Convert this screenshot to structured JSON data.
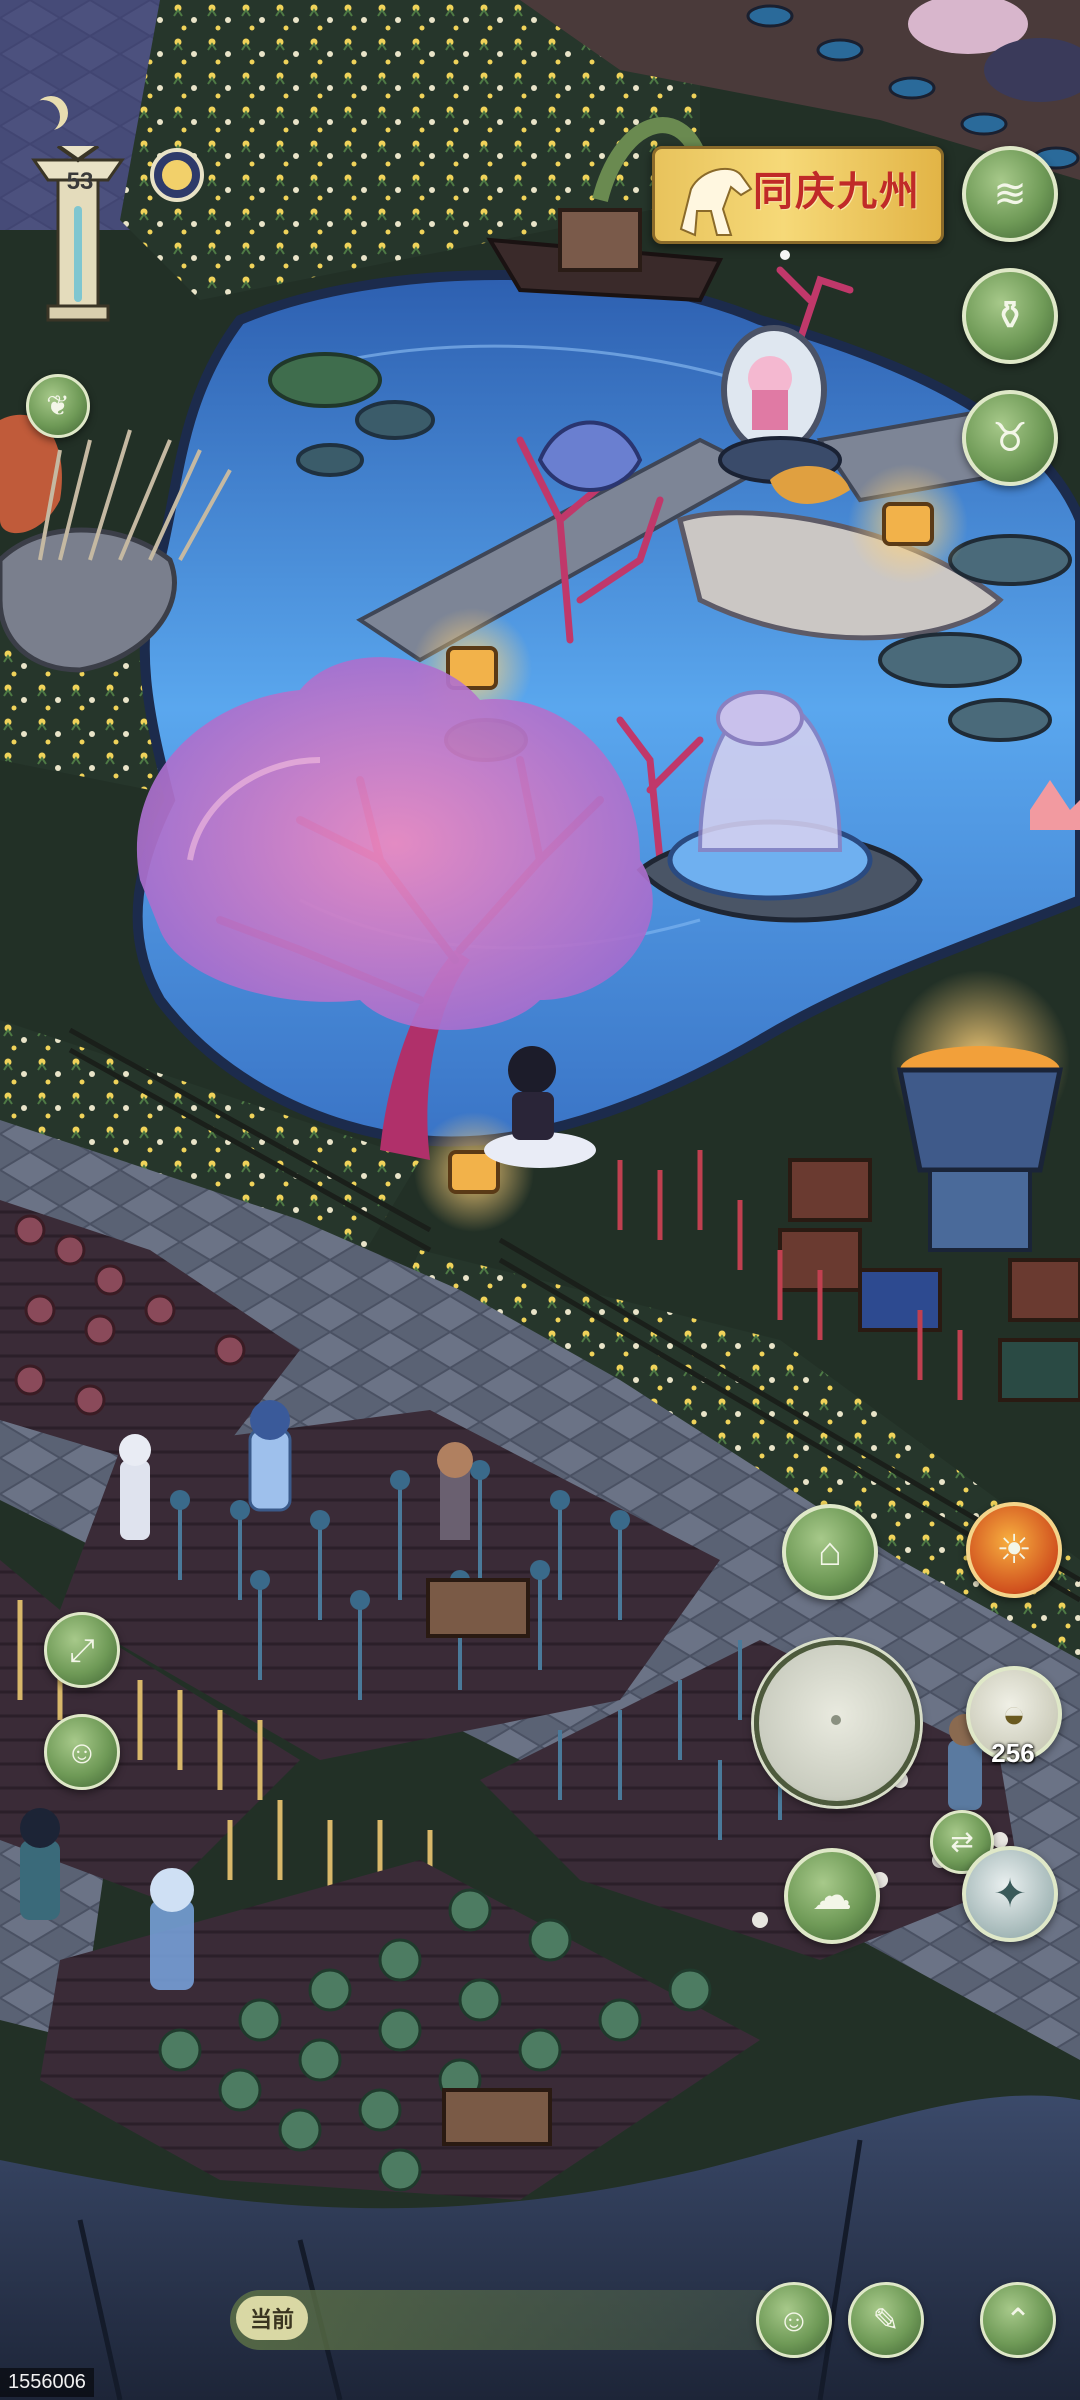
{
  "hud": {
    "level": "53",
    "festival_banner": {
      "text": "同庆九州"
    },
    "coin_count": "256",
    "current_label": "当前",
    "uid": "1556006"
  },
  "icons": {
    "moon": "crescent-moon-icon",
    "level_pillar": "totem-pillar-icon",
    "day_cycle": "sun-clock-icon",
    "leaf": "leaf-icon",
    "wave": "wave-icon",
    "jar": "jar-icon",
    "ox": "ox-head-icon",
    "basket": "seed-basket-icon",
    "lion_dance": "lion-dance-icon",
    "expand": "expand-arrows-icon",
    "character": "character-icon",
    "coin_dish": "coin-dish-icon",
    "swap": "swap-arrows-icon",
    "cloud": "cloud-swirl-icon",
    "compass": "compass-diamond-icon",
    "emote": "smile-face-icon",
    "build": "brush-build-icon",
    "collapse": "chevron-up-icon"
  },
  "colors": {
    "pond": "#4f8fd8",
    "tree_blossom": "#d36aa6",
    "grass": "#2a3b2d",
    "soil": "#3b2d38",
    "path": "#5d6576",
    "button_green": "#6f9a57",
    "banner_gold": "#f6d978",
    "banner_text": "#c02a28"
  }
}
